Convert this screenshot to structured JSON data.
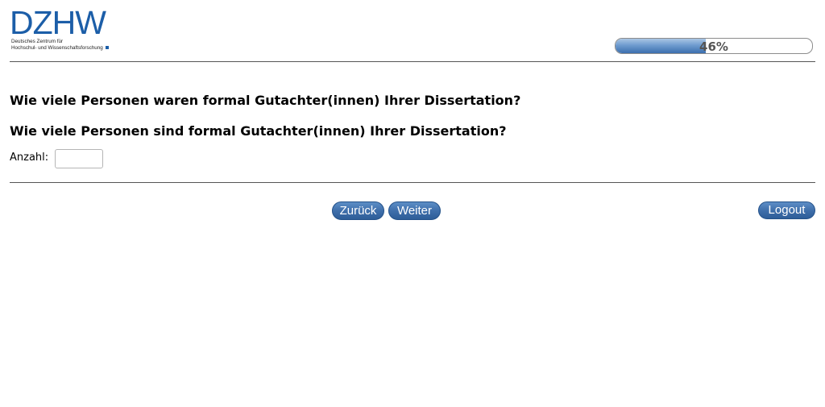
{
  "header": {
    "logo_text": "DZHW",
    "logo_subtitle_line1": "Deutsches Zentrum für",
    "logo_subtitle_line2": "Hochschul- und Wissenschaftsforschung",
    "brand_color": "#1c5ea8",
    "progress": {
      "percent": 46,
      "label": "46%"
    }
  },
  "main": {
    "question_1": "Wie viele Personen waren formal Gutachter(innen) Ihrer Dissertation?",
    "question_2": "Wie viele Personen sind formal Gutachter(innen) Ihrer Dissertation?",
    "answer": {
      "label": "Anzahl:",
      "value": "",
      "placeholder": ""
    }
  },
  "navigation": {
    "back_label": "Zurück",
    "next_label": "Weiter",
    "logout_label": "Logout",
    "button_color": "#3f6fab"
  }
}
